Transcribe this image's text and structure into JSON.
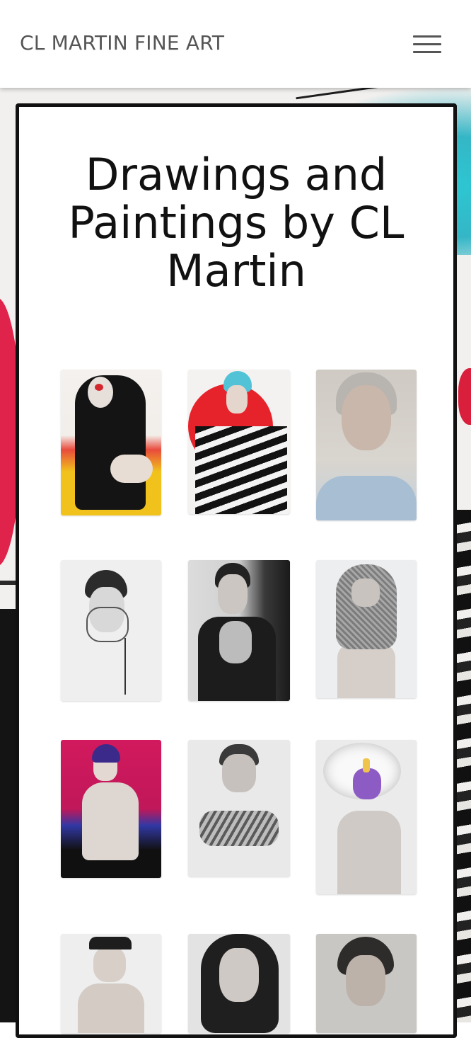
{
  "header": {
    "site_title": "CL MARTIN FINE ART",
    "menu_icon": "hamburger-menu-icon"
  },
  "main": {
    "title": "Drawings and Paintings by CL Martin"
  },
  "gallery": {
    "item_count_visible": 12,
    "items": [
      {
        "subject": "seated figure with red face mark, yellow and red background"
      },
      {
        "subject": "figure with cyan hair in front of red circle"
      },
      {
        "subject": "realistic portrait with blue shirt"
      },
      {
        "subject": "sketch of face behind hands"
      },
      {
        "subject": "black and white tattooed figure"
      },
      {
        "subject": "figure in chainmail hood"
      },
      {
        "subject": "nude figure on magenta background"
      },
      {
        "subject": "tattooed figure with crossed arms"
      },
      {
        "subject": "figure wearing unicorn mask"
      },
      {
        "subject": "figure wearing cap"
      },
      {
        "subject": "portrait with curly hair"
      },
      {
        "subject": "portrait with short dark hair"
      }
    ]
  },
  "colors": {
    "header_text": "#555555",
    "panel_border": "#111111",
    "background_accent_red": "#e0234a",
    "background_accent_cyan": "#34b6c6"
  }
}
